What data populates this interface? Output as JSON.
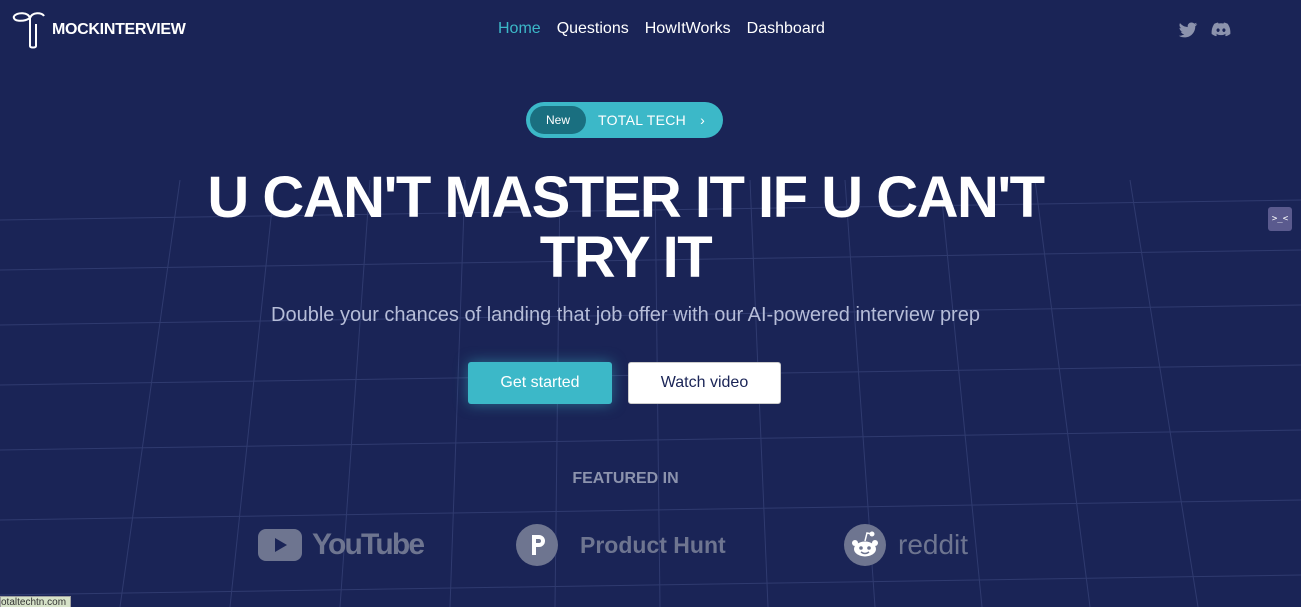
{
  "header": {
    "logo_text": "MOCKINTERVIEW",
    "nav": [
      "Home",
      "Questions",
      "HowItWorks",
      "Dashboard"
    ],
    "social_icons": [
      "twitter-icon",
      "discord-icon"
    ]
  },
  "side_widget": {
    "text": ">_<"
  },
  "badge": {
    "tag": "New",
    "label": "TOTAL TECH",
    "chevron": "›"
  },
  "hero": {
    "headline_line1": "U CAN'T MASTER IT IF U CAN'T",
    "headline_line2": "TRY IT",
    "subtitle": "Double your chances of landing that job offer with our AI-powered interview prep",
    "primary_cta": "Get started",
    "secondary_cta": "Watch video"
  },
  "featured": {
    "title": "FEATURED IN",
    "logos": [
      "YouTube",
      "Product Hunt",
      "reddit"
    ]
  },
  "status_bar": {
    "url": "otaltechtn.com"
  },
  "colors": {
    "background": "#1a2456",
    "accent": "#3cb8c8",
    "muted": "#6e7590"
  }
}
